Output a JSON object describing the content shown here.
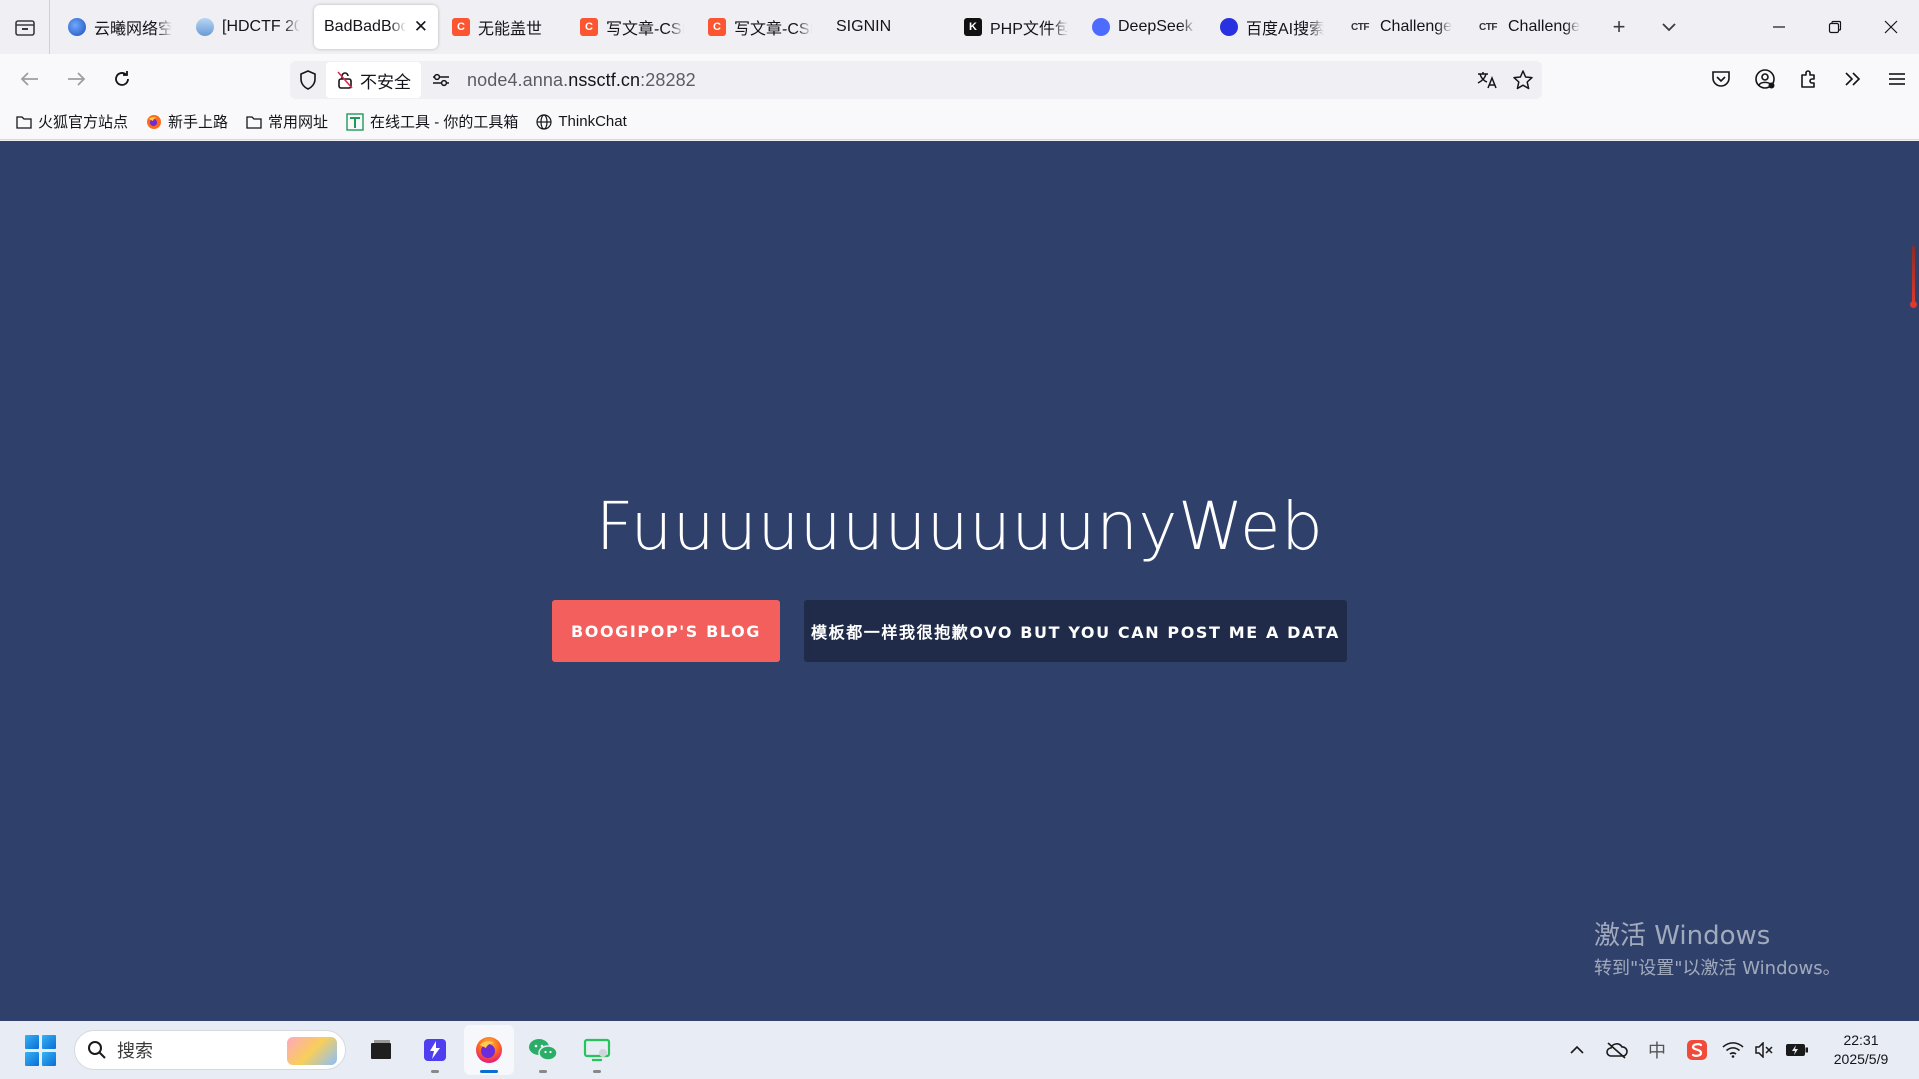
{
  "window": {
    "tabs": [
      {
        "title": "云曦网络空",
        "favicon": "globe-icon",
        "active": false
      },
      {
        "title": "[HDCTF 20",
        "favicon": "cloud-icon",
        "active": false
      },
      {
        "title": "BadBadBoo",
        "favicon": "",
        "active": true
      },
      {
        "title": "无能盖世",
        "favicon": "csdn-icon",
        "active": false
      },
      {
        "title": "写文章-CSI",
        "favicon": "csdn-icon",
        "active": false
      },
      {
        "title": "写文章-CSI",
        "favicon": "csdn-icon",
        "active": false
      },
      {
        "title": "SIGNIN",
        "favicon": "",
        "active": false
      },
      {
        "title": "PHP文件包",
        "favicon": "k-icon",
        "active": false
      },
      {
        "title": "DeepSeek",
        "favicon": "deepseek-icon",
        "active": false
      },
      {
        "title": "百度AI搜索",
        "favicon": "baidu-icon",
        "active": false
      },
      {
        "title": "Challenge",
        "favicon": "ctf-icon",
        "active": false
      },
      {
        "title": "Challenge",
        "favicon": "ctf-icon",
        "active": false
      }
    ],
    "tab_close_glyph": "✕",
    "new_tab_glyph": "+",
    "list_all_glyph": "⌄",
    "ctf_favicon_text": "CTF",
    "csdn_favicon_text": "C",
    "k_favicon_text": "K"
  },
  "nav": {
    "security_label": "不安全",
    "url_prefix": "node4.anna.",
    "url_host": "nssctf.cn",
    "url_port": ":28282"
  },
  "bookmarks": [
    {
      "label": "火狐官方站点",
      "icon": "folder-icon"
    },
    {
      "label": "新手上路",
      "icon": "firefox-icon"
    },
    {
      "label": "常用网址",
      "icon": "folder-icon"
    },
    {
      "label": "在线工具 - 你的工具箱",
      "icon": "toolbox-icon"
    },
    {
      "label": "ThinkChat",
      "icon": "globe-outline-icon"
    }
  ],
  "page": {
    "background": "#2f406b",
    "title": "FuuuuuuuuuuunyWeb",
    "buttons": {
      "blog": "BOOGIPOP'S BLOG",
      "post": "模板都一样我很抱歉OVO BUT YOU CAN POST ME A DATA"
    },
    "accent_color": "#f25f5c",
    "dark_button_color": "#1f2b48"
  },
  "watermark": {
    "title": "激活 Windows",
    "subtitle": "转到\"设置\"以激活 Windows。"
  },
  "taskbar": {
    "search_placeholder": "搜索",
    "time": "22:31",
    "date": "2025/5/9",
    "tray_ime": "中"
  }
}
